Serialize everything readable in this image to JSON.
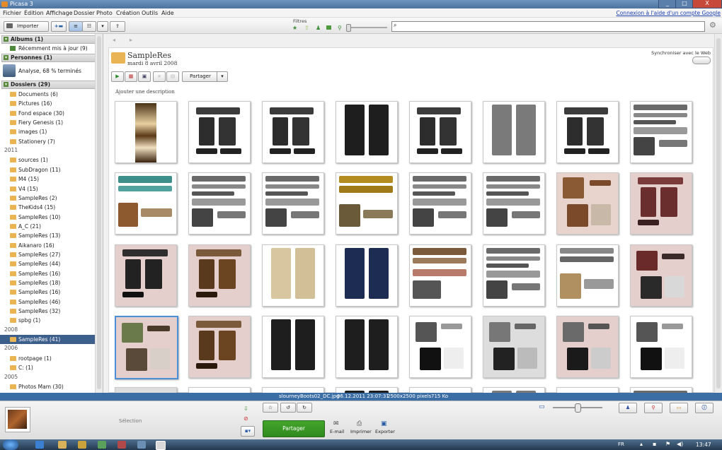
{
  "window": {
    "title": "Picasa 3",
    "min": "_",
    "max": "□",
    "close": "X"
  },
  "menu": {
    "items": [
      "Fichier",
      "Édition",
      "Affichage",
      "Dossier",
      "Photo",
      "Création",
      "Outils",
      "Aide"
    ],
    "google_link": "Connexion à l'aide d'un compte Google"
  },
  "toolbar": {
    "import_label": "Importer",
    "filters_label": "Filtres"
  },
  "sidebar": {
    "albums": {
      "header": "Albums (1)",
      "items": [
        {
          "label": "Récemment mis à jour (9)"
        }
      ]
    },
    "people": {
      "header": "Personnes (1)",
      "analysis": "Analyse, 68 % terminés"
    },
    "folders": {
      "header": "Dossiers (29)",
      "groups": [
        {
          "year": "",
          "items": [
            "Documents (6)",
            "Pictures (16)",
            "Fond espace (30)",
            "Fiery Genesis (1)",
            "images (1)",
            "Stationery (7)"
          ]
        },
        {
          "year": "2011",
          "items": [
            "sources (1)",
            "SubDragon (11)",
            "M4 (15)",
            "V4 (15)",
            "SampleRes (2)",
            "TheKids4 (15)",
            "SampleRes (10)",
            "A_C (21)",
            "SampleRes (13)",
            "Aikanaro (16)",
            "SampleRes (27)",
            "SampleRes (44)",
            "SampleRes (16)",
            "SampleRes (18)",
            "SampleRes (16)",
            "SampleRes (46)",
            "SampleRes (32)",
            "spbg (1)"
          ]
        },
        {
          "year": "2008",
          "items": [
            "SampleRes (41)"
          ]
        },
        {
          "year": "2006",
          "items": [
            "rootpage (1)",
            "C: (1)"
          ]
        },
        {
          "year": "2005",
          "items": [
            "Photos Mam (30)"
          ]
        }
      ],
      "selected": "SampleRes (41)"
    }
  },
  "album": {
    "name": "SampleRes",
    "date": "mardi 8 avril 2008",
    "sync_label": "Synchroniser avec le Web",
    "share_label": "Partager",
    "add_description": "Ajouter une description"
  },
  "infobar": {
    "filename": "slourneyBoots02_DC.jpg",
    "date": "06.12.2011 23:07:31",
    "dimensions": "2500x2500 pixels",
    "size": "715 Ko"
  },
  "tray": {
    "selection_label": "Sélection",
    "share_button": "Partager",
    "email_label": "E-mail",
    "print_label": "Imprimer",
    "export_label": "Exporter"
  },
  "taskbar": {
    "lang": "FR",
    "time": "13:47"
  },
  "thumbnails": [
    "boots-texture",
    "boots-texture",
    "black-leggings",
    "boots-texture",
    "gray-leggings",
    "boots-texture",
    "strap-sheet",
    "teal-strap-sheet",
    "strap-sheet",
    "strap-sheet",
    "gold-strap-sheet",
    "strap-sheet",
    "strap-sheet",
    "leather-top",
    "red-boots",
    "dark-boots",
    "brown-boots",
    "cream-leggings",
    "navy-leggings",
    "brown-strap-sheet",
    "strap-sheet",
    "tan-strap-sheet",
    "red-top",
    "camo-top",
    "brown-boots",
    "black-leggings",
    "black-leggings",
    "bw-top",
    "gray-top",
    "pink-top",
    "bw-top",
    "gray-top"
  ],
  "colors": {
    "accent": "#3b6ea5",
    "selected_row": "#3d5f8c",
    "share_green": "#2f8a1e"
  }
}
